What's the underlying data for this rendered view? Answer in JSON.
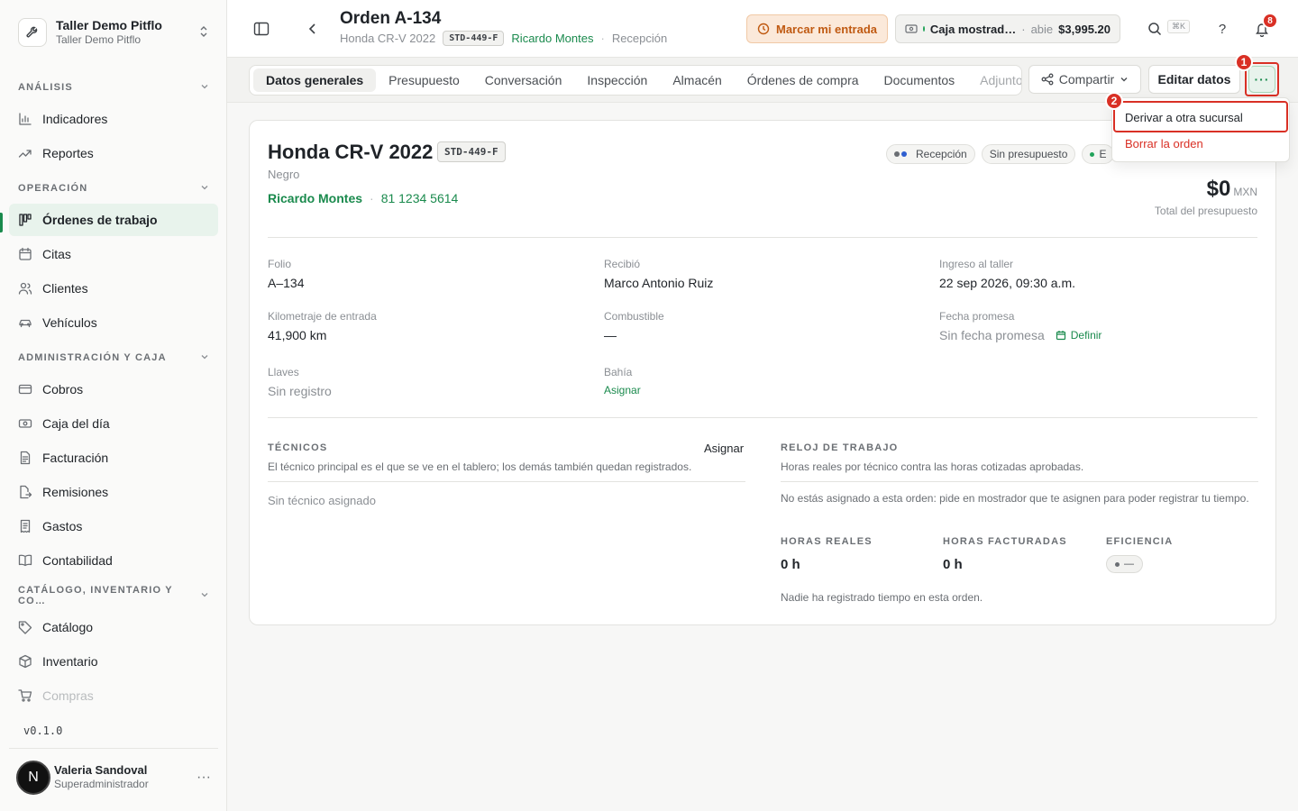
{
  "workspace": {
    "name": "Taller Demo Pitflo",
    "subtitle": "Taller Demo Pitflo"
  },
  "sidebar": {
    "sections": [
      {
        "title": "ANÁLISIS",
        "items": [
          {
            "label": "Indicadores",
            "icon": "bar-chart-icon"
          },
          {
            "label": "Reportes",
            "icon": "trend-icon"
          }
        ]
      },
      {
        "title": "OPERACIÓN",
        "items": [
          {
            "label": "Órdenes de trabajo",
            "icon": "kanban-icon",
            "active": true
          },
          {
            "label": "Citas",
            "icon": "calendar-icon"
          },
          {
            "label": "Clientes",
            "icon": "users-icon"
          },
          {
            "label": "Vehículos",
            "icon": "car-icon"
          }
        ]
      },
      {
        "title": "ADMINISTRACIÓN Y CAJA",
        "items": [
          {
            "label": "Cobros",
            "icon": "card-icon"
          },
          {
            "label": "Caja del día",
            "icon": "cash-icon"
          },
          {
            "label": "Facturación",
            "icon": "invoice-icon"
          },
          {
            "label": "Remisiones",
            "icon": "file-export-icon"
          },
          {
            "label": "Gastos",
            "icon": "receipt-icon"
          },
          {
            "label": "Contabilidad",
            "icon": "book-icon"
          }
        ]
      },
      {
        "title": "CATÁLOGO, INVENTARIO Y CO…",
        "items": [
          {
            "label": "Catálogo",
            "icon": "tag-icon"
          },
          {
            "label": "Inventario",
            "icon": "box-icon"
          },
          {
            "label": "Compras",
            "icon": "cart-icon"
          }
        ]
      }
    ],
    "version": "v0.1.0",
    "user": {
      "initial": "N",
      "name": "Valeria Sandoval",
      "role": "Superadministrador"
    }
  },
  "header": {
    "title": "Orden A-134",
    "vehicle": "Honda CR-V 2022",
    "plate": "STD-449-F",
    "customer": "Ricardo Montes",
    "status": "Recepción",
    "checkin_label": "Marcar mi entrada",
    "cash": {
      "name": "Caja mostrad…",
      "sep": "·",
      "status": "abie",
      "amount": "$3,995.20"
    },
    "search_shortcut": "⌘K",
    "help": "?",
    "notifications_count": "8"
  },
  "tabs": [
    "Datos generales",
    "Presupuesto",
    "Conversación",
    "Inspección",
    "Almacén",
    "Órdenes de compra",
    "Documentos",
    "Adjuntos"
  ],
  "actions": {
    "share": "Compartir",
    "edit": "Editar datos",
    "more": "···"
  },
  "dropdown": {
    "transfer": "Derivar a otra sucursal",
    "delete": "Borrar la orden"
  },
  "annotations": {
    "step1": "1",
    "step2": "2"
  },
  "card": {
    "title": "Honda CR-V 2022",
    "plate": "STD-449-F",
    "color": "Negro",
    "customer": "Ricardo Montes",
    "phone": "81 1234 5614",
    "pills": [
      "Recepción",
      "Sin presupuesto",
      "E"
    ],
    "total_amount": "$0",
    "total_currency": "MXN",
    "total_label": "Total del presupuesto",
    "fields": {
      "folio_label": "Folio",
      "folio": "A–134",
      "received_label": "Recibió",
      "received": "Marco Antonio Ruiz",
      "entry_label": "Ingreso al taller",
      "entry": "22 sep 2026, 09:30 a.m.",
      "km_label": "Kilometraje de entrada",
      "km": "41,900 km",
      "fuel_label": "Combustible",
      "fuel": "—",
      "promise_label": "Fecha promesa",
      "promise": "Sin fecha promesa",
      "promise_action": "Definir",
      "keys_label": "Llaves",
      "keys": "Sin registro",
      "bay_label": "Bahía",
      "bay": "Asignar"
    },
    "technicians": {
      "title": "TÉCNICOS",
      "assign": "Asignar",
      "desc": "El técnico principal es el que se ve en el tablero; los demás también quedan registrados.",
      "empty": "Sin técnico asignado"
    },
    "clock": {
      "title": "RELOJ DE TRABAJO",
      "desc": "Horas reales por técnico contra las horas cotizadas aprobadas.",
      "notice": "No estás asignado a esta orden: pide en mostrador que te asignen para poder registrar tu tiempo.",
      "real_label": "HORAS REALES",
      "real": "0 h",
      "billed_label": "HORAS FACTURADAS",
      "billed": "0 h",
      "eff_label": "EFICIENCIA",
      "eff": "—",
      "empty": "Nadie ha registrado tiempo en esta orden."
    }
  },
  "colors": {
    "accent": "#1a8a4d",
    "danger": "#d93025",
    "checkin_bg": "#fbe9da"
  }
}
